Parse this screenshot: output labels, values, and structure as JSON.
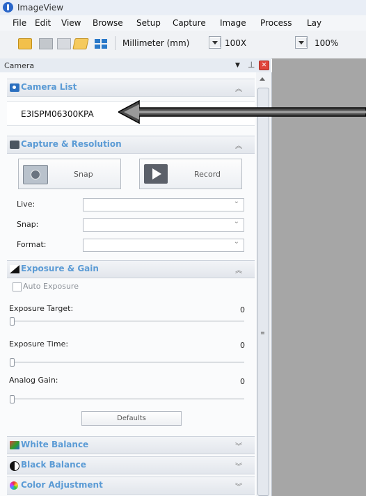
{
  "app": {
    "title": "ImageView"
  },
  "menu": [
    "File",
    "Edit",
    "View",
    "Browse",
    "Setup",
    "Capture",
    "Image",
    "Process",
    "Lay"
  ],
  "toolbar": {
    "unit": "Millimeter (mm)",
    "magnification": "100X",
    "zoom": "100%"
  },
  "dock": {
    "title": "Camera"
  },
  "camera_list": {
    "title": "Camera List",
    "camera": "E3ISPM06300KPA"
  },
  "capture": {
    "title": "Capture & Resolution",
    "snap_label": "Snap",
    "record_label": "Record",
    "fields": {
      "live": "Live:",
      "snap": "Snap:",
      "format": "Format:"
    }
  },
  "exposure": {
    "title": "Exposure & Gain",
    "auto_label": "Auto Exposure",
    "target_label": "Exposure Target:",
    "target_value": "0",
    "time_label": "Exposure Time:",
    "time_value": "0",
    "gain_label": "Analog Gain:",
    "gain_value": "0",
    "defaults_label": "Defaults"
  },
  "sections": {
    "white_balance": "White Balance",
    "black_balance": "Black Balance",
    "color_adjustment": "Color Adjustment"
  },
  "icons": [
    "app-icon",
    "folder-icon",
    "save-icon",
    "save-all-icon",
    "open-folder-icon",
    "grid-icon",
    "pin-icon",
    "close-icon",
    "camera-icon",
    "snap-camera-icon",
    "record-icon",
    "exposure-icon",
    "white-balance-icon",
    "black-balance-icon",
    "color-wheel-icon",
    "arrow-annotation"
  ]
}
